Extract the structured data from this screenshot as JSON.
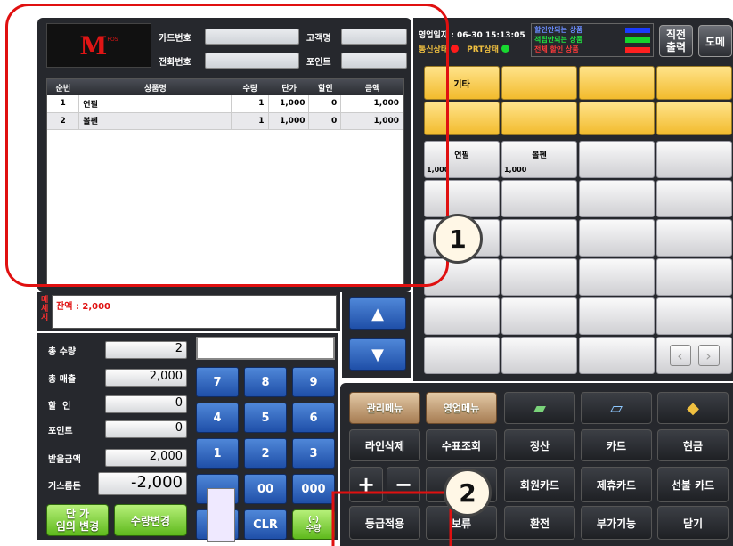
{
  "header": {
    "logo": "M",
    "logo_sub": "POS",
    "card_no_label": "카드번호",
    "customer_label": "고객명",
    "phone_label": "전화번호",
    "point_label": "포인트"
  },
  "table": {
    "columns": [
      "순번",
      "상품명",
      "수량",
      "단가",
      "할인",
      "금액"
    ],
    "rows": [
      {
        "no": "1",
        "name": "연필",
        "qty": "1",
        "price": "1,000",
        "discount": "0",
        "amount": "1,000"
      },
      {
        "no": "2",
        "name": "볼펜",
        "qty": "1",
        "price": "1,000",
        "discount": "0",
        "amount": "1,000"
      }
    ]
  },
  "message": {
    "label": "메세지",
    "text": "잔액 :  2,000"
  },
  "summary": {
    "total_qty_label": "총 수량",
    "total_qty": "2",
    "total_sales_label": "총 매출",
    "total_sales": "2,000",
    "discount_label": "할  인",
    "discount": "0",
    "point_label": "포인트",
    "point": "0",
    "received_label": "받을금액",
    "received": "2,000",
    "change_label": "거스름돈",
    "change": "-2,000"
  },
  "bottom_buttons": {
    "price_change": "단 가\n임의 변경",
    "qty_change": "수량변경",
    "partial": "(-)\n수량"
  },
  "keypad": [
    "7",
    "8",
    "9",
    "4",
    "5",
    "6",
    "1",
    "2",
    "3",
    "",
    "00",
    "000",
    "",
    "CLR",
    ""
  ],
  "status": {
    "business_date": "영업일자 : 06-30 15:13:05",
    "comm_status": "통신상태",
    "prt_status": "PRT상태",
    "legend": [
      {
        "label": "할인안되는 상품",
        "color": "#1a3bff"
      },
      {
        "label": "적립안되는 상품",
        "color": "#16d42c"
      },
      {
        "label": "전체 할인 상품",
        "color": "#ff2020"
      }
    ],
    "reprint": "직전\n출력",
    "help": "도메"
  },
  "categories": {
    "row1": [
      "기타",
      "",
      "",
      ""
    ],
    "row2": [
      "",
      "",
      "",
      ""
    ]
  },
  "products": [
    {
      "name": "연필",
      "price": "1,000"
    },
    {
      "name": "볼펜",
      "price": "1,000"
    }
  ],
  "func_buttons": {
    "admin_menu": "관리메뉴",
    "sales_menu": "영업메뉴",
    "line_delete": "라인삭제",
    "check_inquiry": "수표조회",
    "settle": "정산",
    "card": "카드",
    "cash": "현금",
    "member_card": "회원카드",
    "partner_card": "제휴카드",
    "gift_card": "선불 카드",
    "grade_apply": "등급적용",
    "hold": "보류",
    "exchange": "환전",
    "extra": "부가기능",
    "close": "닫기"
  },
  "callouts": [
    "1",
    "2"
  ],
  "colors": {
    "annotation_red": "#e01010",
    "panel_bg": "#26282d",
    "gold_button": "#f2bb2d",
    "blue_key": "#2b5fb8"
  }
}
